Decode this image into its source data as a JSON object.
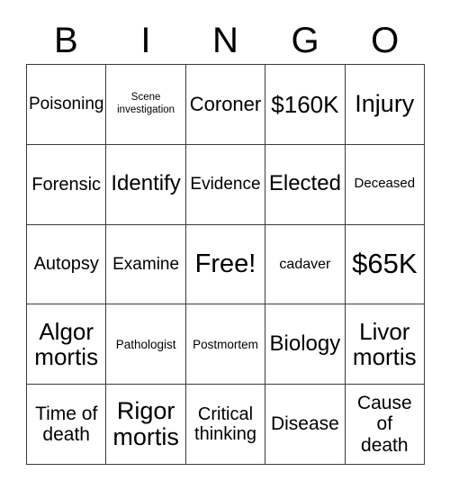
{
  "card": {
    "title": "Bingo Card",
    "header": {
      "letters": [
        "B",
        "I",
        "N",
        "G",
        "O"
      ]
    },
    "colors": {
      "background": "#ffffff",
      "text": "#000000",
      "grid_line": "#3b3b3b"
    },
    "grid": {
      "columns": 5,
      "rows": 5,
      "free_space_index": 12,
      "cells": [
        {
          "label": "Poisoning",
          "size": "fs-19"
        },
        {
          "label": "Scene\ninvestigation",
          "size": "fs-11"
        },
        {
          "label": "Coroner",
          "size": "fs-22"
        },
        {
          "label": "$160K",
          "size": "fs-26"
        },
        {
          "label": "Injury",
          "size": "fs-27"
        },
        {
          "label": "Forensic",
          "size": "fs-20"
        },
        {
          "label": "Identify",
          "size": "fs-24"
        },
        {
          "label": "Evidence",
          "size": "fs-19"
        },
        {
          "label": "Elected",
          "size": "fs-24"
        },
        {
          "label": "Deceased",
          "size": "fs-15"
        },
        {
          "label": "Autopsy",
          "size": "fs-20"
        },
        {
          "label": "Examine",
          "size": "fs-19"
        },
        {
          "label": "Free!",
          "size": "fs-29"
        },
        {
          "label": "cadaver",
          "size": "fs-16"
        },
        {
          "label": "$65K",
          "size": "fs-31"
        },
        {
          "label": "Algor\nmortis",
          "size": "fs-26"
        },
        {
          "label": "Pathologist",
          "size": "fs-14"
        },
        {
          "label": "Postmortem",
          "size": "fs-14"
        },
        {
          "label": "Biology",
          "size": "fs-24"
        },
        {
          "label": "Livor\nmortis",
          "size": "fs-26"
        },
        {
          "label": "Time of\ndeath",
          "size": "fs-21"
        },
        {
          "label": "Rigor\nmortis",
          "size": "fs-27"
        },
        {
          "label": "Critical\nthinking",
          "size": "fs-20"
        },
        {
          "label": "Disease",
          "size": "fs-21"
        },
        {
          "label": "Cause\nof\ndeath",
          "size": "fs-21"
        }
      ]
    }
  }
}
